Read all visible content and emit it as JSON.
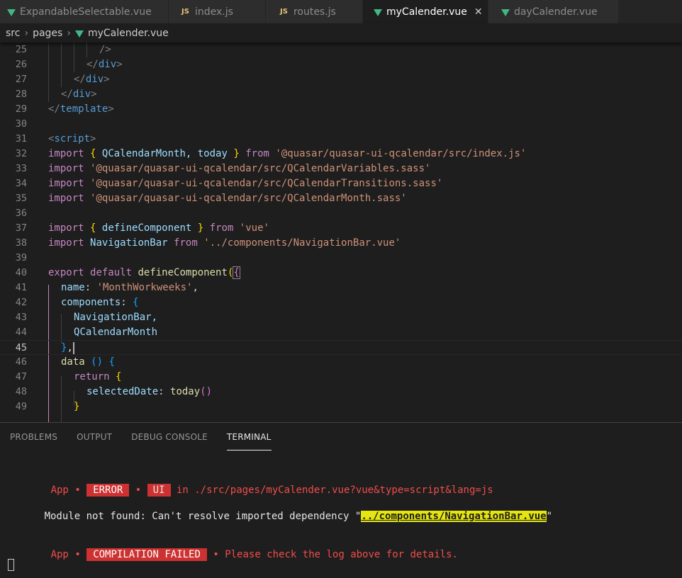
{
  "tabs": [
    {
      "label": "ExpandableSelectable.vue",
      "icon": "vue-icon",
      "active": false
    },
    {
      "label": "index.js",
      "icon": "js-icon",
      "icon_text": "JS",
      "active": false
    },
    {
      "label": "routes.js",
      "icon": "js-icon",
      "icon_text": "JS",
      "active": false
    },
    {
      "label": "myCalender.vue",
      "icon": "vue-icon",
      "active": true,
      "close": "✕"
    },
    {
      "label": "dayCalender.vue",
      "icon": "vue-icon",
      "active": false
    }
  ],
  "breadcrumb": {
    "segments": [
      "src",
      "pages",
      "myCalender.vue"
    ],
    "separator": "›"
  },
  "editor": {
    "current_line": 45,
    "line_numbers": [
      "25",
      "26",
      "27",
      "28",
      "29",
      "30",
      "31",
      "32",
      "33",
      "34",
      "35",
      "36",
      "37",
      "38",
      "39",
      "40",
      "41",
      "42",
      "43",
      "44",
      "45",
      "46",
      "47",
      "48",
      "49"
    ],
    "code": {
      "l25": "/>",
      "l26_close": "</",
      "l26_tag": "div",
      "l26_end": ">",
      "l29_tag": "template",
      "l31_tag": "script",
      "kw_import": "import",
      "kw_from": "from",
      "l32_names": "QCalendarMonth, today",
      "l32_str": "'@quasar/quasar-ui-qcalendar/src/index.js'",
      "l33_str": "'@quasar/quasar-ui-qcalendar/src/QCalendarVariables.sass'",
      "l34_str": "'@quasar/quasar-ui-qcalendar/src/QCalendarTransitions.sass'",
      "l35_str": "'@quasar/quasar-ui-qcalendar/src/QCalendarMonth.sass'",
      "l37_names": "defineComponent",
      "l37_str": "'vue'",
      "l38_name": "NavigationBar",
      "l38_str": "'../components/NavigationBar.vue'",
      "kw_export": "export",
      "kw_default": "default",
      "l40_fn": "defineComponent",
      "l41_key": "name",
      "l41_str": "'MonthWorkweeks'",
      "l42_key": "components",
      "l43_name": "NavigationBar,",
      "l44_name": "QCalendarMonth",
      "l46_fn": "data",
      "kw_return": "return",
      "l48_key": "selectedDate",
      "l48_fn": "today"
    }
  },
  "panel": {
    "tabs": [
      {
        "label": "PROBLEMS",
        "active": false
      },
      {
        "label": "OUTPUT",
        "active": false
      },
      {
        "label": "DEBUG CONSOLE",
        "active": false
      },
      {
        "label": "TERMINAL",
        "active": true
      }
    ],
    "terminal": {
      "line1": {
        "app": "App",
        "dot": "•",
        "error": "ERROR",
        "ui": "UI",
        "rest": "in ./src/pages/myCalender.vue?vue&type=script&lang=js"
      },
      "line2": {
        "prefix": "Module not found: Can't resolve imported dependency \"",
        "path": "../components/NavigationBar.vue",
        "suffix": "\""
      },
      "line3": {
        "app": "App",
        "dot": "•",
        "badge": "COMPILATION FAILED",
        "rest": "• Please check the log above for details."
      }
    }
  },
  "colors": {
    "accent": "#cd3131",
    "vue": "#41b883",
    "highlight": "#e5e510"
  }
}
